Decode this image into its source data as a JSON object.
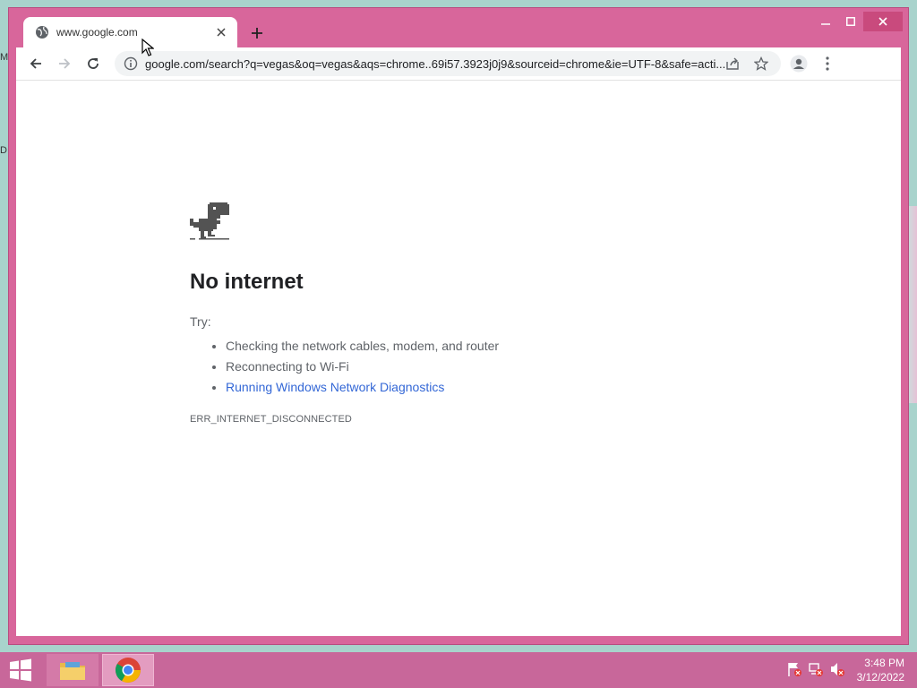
{
  "desktop": {
    "left_fragment_1": "M",
    "left_fragment_2": "D"
  },
  "browser": {
    "tab": {
      "title": "www.google.com"
    },
    "window_controls": {
      "minimize": "–",
      "maximize": "□",
      "close": "✕"
    },
    "address": {
      "url": "google.com/search?q=vegas&oq=vegas&aqs=chrome..69i57.3923j0j9&sourceid=chrome&ie=UTF-8&safe=acti..."
    }
  },
  "page": {
    "title": "No internet",
    "try_label": "Try:",
    "suggestions": [
      "Checking the network cables, modem, and router",
      "Reconnecting to Wi-Fi"
    ],
    "diagnostics_link": "Running Windows Network Diagnostics",
    "error_code": "ERR_INTERNET_DISCONNECTED"
  },
  "taskbar": {
    "clock_time": "3:48 PM",
    "clock_date": "3/12/2022"
  },
  "colors": {
    "window_frame": "#d8669b",
    "taskbar": "#c8679a",
    "link": "#3367d6"
  }
}
